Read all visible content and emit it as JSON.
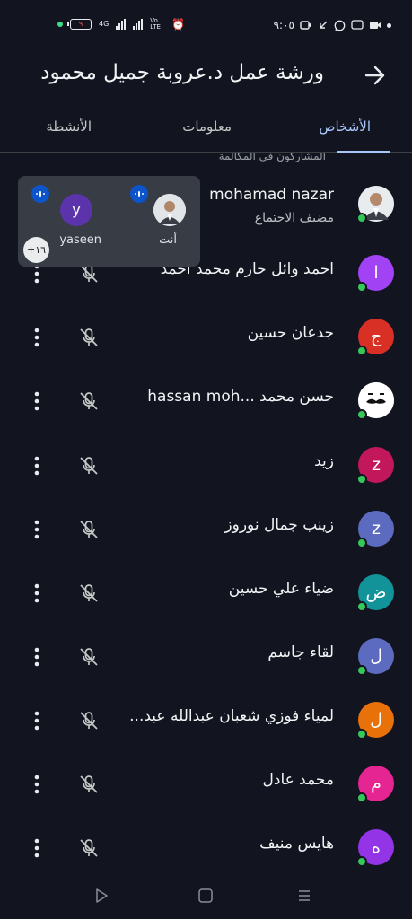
{
  "status_bar": {
    "time": "٩:٠٥",
    "battery": "٩",
    "network": "4G",
    "volte": "Vo LTE"
  },
  "header": {
    "title": "ورشة عمل د.عروبة جميل محمود"
  },
  "tabs": [
    {
      "label": "الأشخاص",
      "active": true
    },
    {
      "label": "معلومات",
      "active": false
    },
    {
      "label": "الأنشطة",
      "active": false
    }
  ],
  "section_label": "المشاركون في المكالمة",
  "self_card": {
    "self_label": "أنت",
    "other_label": "yaseen",
    "other_initial": "y",
    "more_count": "+١٦"
  },
  "participants": [
    {
      "name": "mohamad nazar",
      "role": "مضيف الاجتماع",
      "initial": "",
      "color": "#6b7280",
      "photo": true
    },
    {
      "name": "احمد وائل حازم محمد احمد",
      "initial": "ا",
      "color": "#a142f4"
    },
    {
      "name": "جدعان حسين",
      "initial": "ج",
      "color": "#d93025"
    },
    {
      "name": "حسن محمد ...hassan moh",
      "initial": "",
      "color": "#ffffff",
      "mustache": true
    },
    {
      "name": "زيد",
      "initial": "z",
      "color": "#c2185b"
    },
    {
      "name": "زينب جمال نوروز",
      "initial": "z",
      "color": "#5c6bc0"
    },
    {
      "name": "ضياء علي حسين",
      "initial": "ض",
      "color": "#12939a"
    },
    {
      "name": "لقاء جاسم",
      "initial": "ل",
      "color": "#5c6bc0"
    },
    {
      "name": "لمياء فوزي شعبان عبدالله عبد...",
      "initial": "ل",
      "color": "#e8710a"
    },
    {
      "name": "محمد عادل",
      "initial": "م",
      "color": "#e52592"
    },
    {
      "name": "هايس منيف",
      "initial": "ه",
      "color": "#9334e6"
    }
  ],
  "colors": {
    "background": "#121520",
    "accent": "#a8c7fa",
    "online": "#34c759"
  }
}
